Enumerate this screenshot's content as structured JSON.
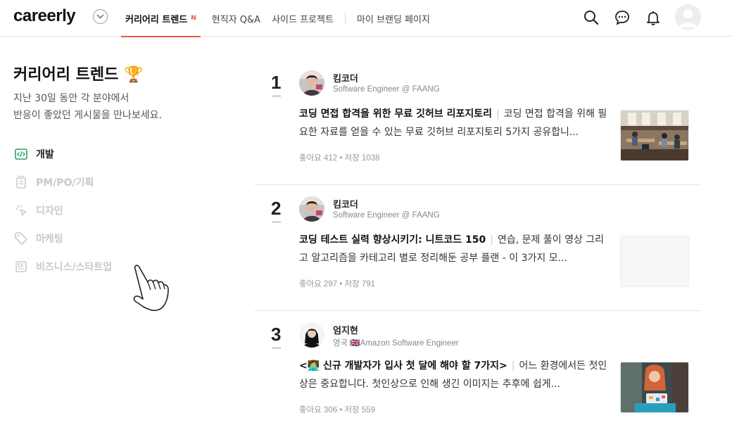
{
  "header": {
    "logo": "careerly",
    "nav": [
      {
        "label": "커리어리 트렌드",
        "badge": "N",
        "active": true
      },
      {
        "label": "현직자 Q&A"
      },
      {
        "label": "사이드 프로젝트"
      },
      {
        "label": "마이 브랜딩 페이지"
      }
    ],
    "icons": [
      "search-icon",
      "chat-icon",
      "bell-icon",
      "profile-avatar"
    ]
  },
  "sidebar": {
    "title": "커리어리 트렌드 🏆",
    "desc_line1": "지난 30일 동안 각 분야에서",
    "desc_line2": "반응이 좋았던 게시물을 만나보세요.",
    "categories": [
      {
        "label": "개발",
        "icon": "code-icon",
        "active": true
      },
      {
        "label": "PM/PO/기획",
        "icon": "clipboard-icon",
        "active": false
      },
      {
        "label": "디자인",
        "icon": "cursor-click-icon",
        "active": false
      },
      {
        "label": "마케팅",
        "icon": "tag-icon",
        "active": false
      },
      {
        "label": "비즈니스/스타트업",
        "icon": "newspaper-icon",
        "active": false
      }
    ]
  },
  "posts": [
    {
      "rank": "1",
      "author": "킴코더",
      "meta": "Software Engineer @ FAANG",
      "title": "코딩 면접 합격을 위한 무료 깃허브 리포지토리",
      "summary": "코딩 면접 합격을 위해 필요한 자료를 얻을 수 있는 무료 깃허브 리포지토리 5가지 공유합니...",
      "stats": "좋아요 412 • 저장 1038",
      "thumb": "office-photo"
    },
    {
      "rank": "2",
      "author": "킴코더",
      "meta": "Software Engineer @ FAANG",
      "title": "코딩 테스트 실력 향상시키기: 니트코드 150",
      "summary": "연습, 문제 풀이 영상 그리고 알고리즘을 카테고리 별로 정리해둔 공부 플랜 - 이 3가지 모...",
      "stats": "좋아요 297 • 저장 791",
      "thumb": "blank"
    },
    {
      "rank": "3",
      "author": "엄지현",
      "meta": "영국 🇬🇧Amazon Software Engineer",
      "title": "<👩‍💻 신규 개발자가 입사 첫 달에 해야 할 7가지>",
      "summary": "어느 환경에서든 첫인상은 중요합니다. 첫인상으로 인해 생긴 이미지는 추후에 쉽게...",
      "stats": "좋아요 306 • 저장 559",
      "thumb": "person-laptop-photo"
    }
  ]
}
